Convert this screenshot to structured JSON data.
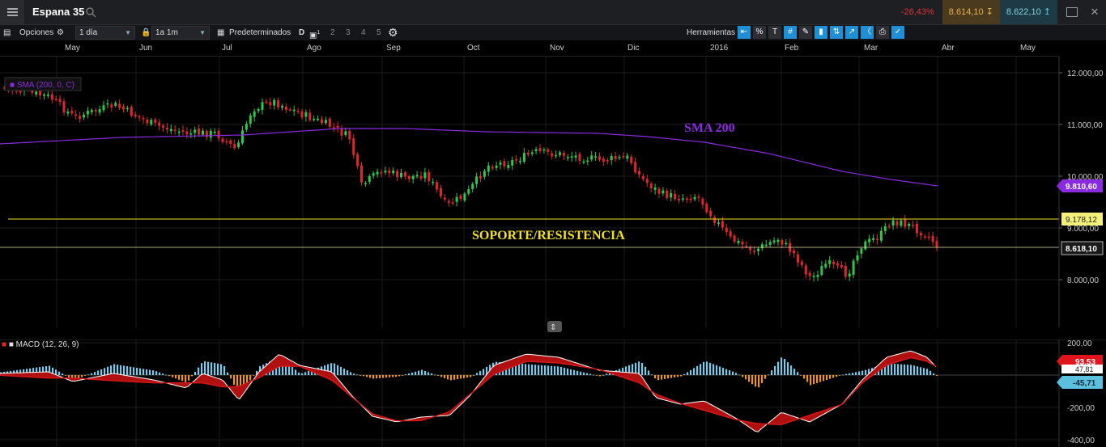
{
  "topbar": {
    "instrument": "Espana 35",
    "change_pct": "-26,43%",
    "sell_price": "8.614,10",
    "buy_price": "8.622,10",
    "icons": [
      "menu-icon",
      "search-icon",
      "restore-window-icon",
      "close-icon"
    ]
  },
  "toolbar": {
    "options_label": "Opciones",
    "interval": "1 día",
    "range": "1a 1m",
    "presets_label": "Predeterminados",
    "layout_label": "D",
    "layout_count": "1",
    "layout_numbers": [
      "2",
      "3",
      "4",
      "5"
    ],
    "tools_label": "Herramientas",
    "tool_icons": [
      "percent-icon",
      "text-icon",
      "grid-icon",
      "pen-icon",
      "candle-icon",
      "compare-icon",
      "line-chart-icon",
      "tag-icon",
      "print-icon",
      "settings-tool-icon"
    ]
  },
  "months": [
    "May",
    "Jun",
    "Jul",
    "Ago",
    "Sep",
    "Oct",
    "Nov",
    "Dic",
    "2016",
    "Feb",
    "Mar",
    "Abr",
    "May"
  ],
  "price_panel": {
    "indicator_label": "SMA (200, 0, C)",
    "y_ticks": [
      "12.000,00",
      "11.000,00",
      "10.000,00",
      "9.000,00",
      "8.000,00"
    ],
    "sma_tag": "9.810,60",
    "line_tag": "9.178,12",
    "last_tag": "8.618,10",
    "annotation_sma": "SMA 200",
    "annotation_sr": "SOPORTE/RESISTENCIA",
    "colors": {
      "up": "#2ec74a",
      "down": "#e0252b",
      "sma": "#8a2be2",
      "sr_line": "#f0e020"
    }
  },
  "macd_panel": {
    "indicator_label": "MACD (12, 26, 9)",
    "y_ticks": [
      "200,00",
      "-200,00",
      "-400,00"
    ],
    "tag_macd": "93,53",
    "tag_signal": "47,81",
    "tag_hist": "-45,71",
    "colors": {
      "macd": "#ffffff",
      "signal": "#d81818",
      "hist_up": "#7fc8e8",
      "hist_down": "#e8943a"
    }
  }
}
